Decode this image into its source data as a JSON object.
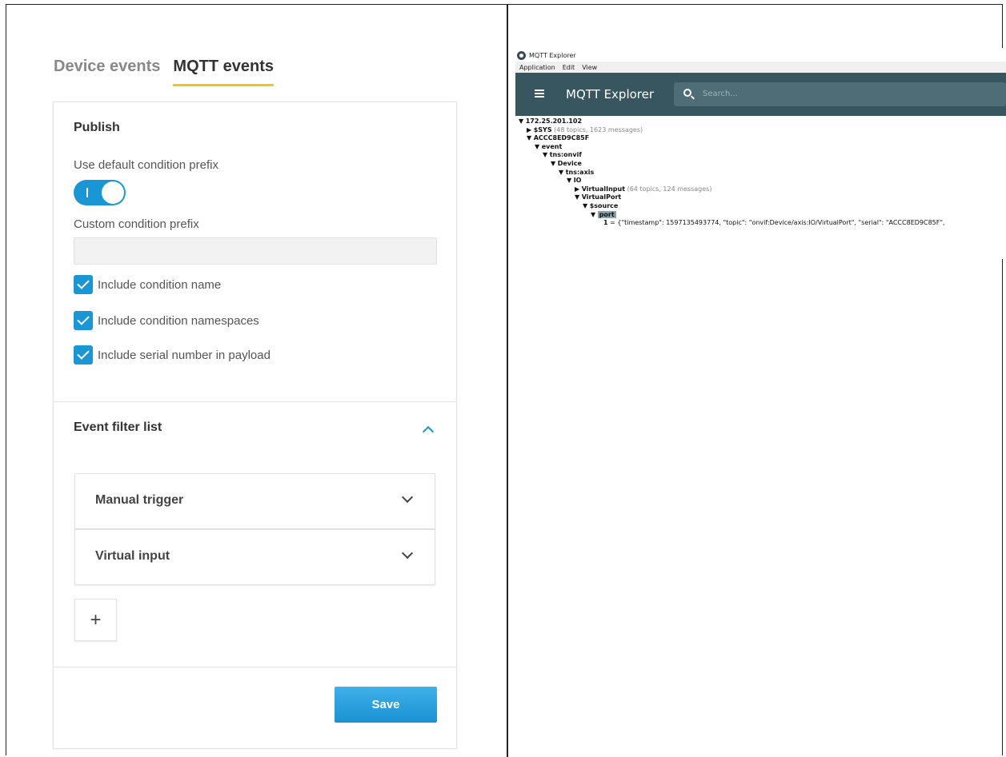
{
  "left": {
    "tabs": [
      {
        "label": "Device events",
        "active": false
      },
      {
        "label": "MQTT events",
        "active": true
      }
    ],
    "publish": {
      "title": "Publish",
      "use_default_label": "Use default condition prefix",
      "use_default_on": true,
      "toggle_glyph": "I",
      "custom_prefix_label": "Custom condition prefix",
      "custom_prefix_value": "",
      "checkboxes": [
        {
          "label": "Include condition name",
          "checked": true
        },
        {
          "label": "Include condition namespaces",
          "checked": true
        },
        {
          "label": "Include serial number in payload",
          "checked": true
        }
      ]
    },
    "filter": {
      "title": "Event filter list",
      "items": [
        {
          "label": "Manual trigger"
        },
        {
          "label": "Virtual input"
        }
      ],
      "add_label": "+"
    },
    "save_label": "Save",
    "accent": "#1a96d5",
    "tab_underline": "#f5c518"
  },
  "mqtt_explorer": {
    "window_title": "MQTT Explorer",
    "menu": [
      "Application",
      "Edit",
      "View"
    ],
    "app_title": "MQTT Explorer",
    "search_placeholder": "Search...",
    "appbar_color": "#37565f",
    "tree": [
      {
        "arrow": "▼",
        "name": "172.25.201.102",
        "meta": "",
        "depth": 0
      },
      {
        "arrow": "▶",
        "name": "$SYS",
        "meta": "(48 topics, 1623 messages)",
        "depth": 1
      },
      {
        "arrow": "▼",
        "name": "ACCC8ED9C85F",
        "meta": "",
        "depth": 1
      },
      {
        "arrow": "▼",
        "name": "event",
        "meta": "",
        "depth": 2
      },
      {
        "arrow": "▼",
        "name": "tns:onvif",
        "meta": "",
        "depth": 3
      },
      {
        "arrow": "▼",
        "name": "Device",
        "meta": "",
        "depth": 4
      },
      {
        "arrow": "▼",
        "name": "tns:axis",
        "meta": "",
        "depth": 5
      },
      {
        "arrow": "▼",
        "name": "IO",
        "meta": "",
        "depth": 6
      },
      {
        "arrow": "▶",
        "name": "VirtualInput",
        "meta": "(64 topics, 124 messages)",
        "depth": 7
      },
      {
        "arrow": "▼",
        "name": "VirtualPort",
        "meta": "",
        "depth": 7
      },
      {
        "arrow": "▼",
        "name": "$source",
        "meta": "",
        "depth": 8
      },
      {
        "arrow": "▼",
        "name": "port",
        "meta": "",
        "depth": 9,
        "selected": true
      }
    ],
    "value_line": {
      "key": "1",
      "value": " = {\"timestamp\": 1597135493774, \"topic\": \"onvif:Device/axis:IO/VirtualPort\", \"serial\": \"ACCC8ED9C85F\","
    }
  }
}
